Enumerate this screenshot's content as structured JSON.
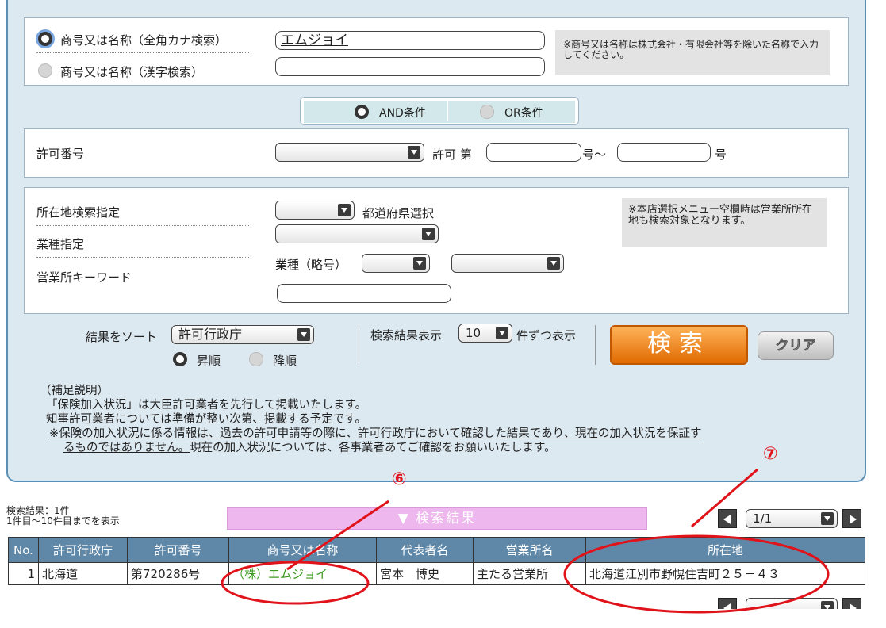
{
  "name_search": {
    "kana_label": "商号又は名称（全角カナ検索）",
    "kanji_label": "商号又は名称（漢字検索）",
    "kana_value": "エムジョイ",
    "kanji_value": "",
    "note": "※商号又は名称は株式会社・有限会社等を除いた名称で入力してください。"
  },
  "condition": {
    "and_label": "AND条件",
    "or_label": "OR条件"
  },
  "permit": {
    "label": "許可番号",
    "prefix": "許可 第",
    "mid": "号～",
    "suffix": "号",
    "from_value": "",
    "to_value": ""
  },
  "location": {
    "label": "所在地検索指定",
    "pref_label": "都道府県選択",
    "industry_label": "業種指定",
    "keyword_label": "営業所キーワード",
    "abbr_label": "業種（略号）",
    "note": "※本店選択メニュー空欄時は営業所所在地も検索対象となります。"
  },
  "sort": {
    "label": "結果をソート",
    "value": "許可行政庁",
    "asc": "昇順",
    "desc": "降順",
    "count_label": "検索結果表示",
    "count_value": "10",
    "count_suffix": "件ずつ表示"
  },
  "buttons": {
    "search": "検索",
    "clear": "クリア"
  },
  "explain": {
    "l1": "（補足説明）",
    "l2": "「保険加入状況」は大臣許可業者を先行して掲載いたします。",
    "l3": "知事許可業者については準備が整い次第、掲載する予定です。",
    "l4": "※保険の加入状況に係る情報は、過去の許可申請等の際に、許可行政庁において確認した結果であり、現在の加入状況を保証す",
    "l5a": "るものではありません。",
    "l5b": "現在の加入状況については、各事業者あてご確認をお願いいたします。"
  },
  "results": {
    "count_line1": "検索結果：1件",
    "count_line2": "1件目～10件目までを表示",
    "bar_title": "▼ 検索結果",
    "page": "1/1",
    "headers": [
      "No.",
      "許可行政庁",
      "許可番号",
      "商号又は名称",
      "代表者名",
      "営業所名",
      "所在地"
    ],
    "rows": [
      {
        "no": "1",
        "authority": "北海道",
        "permit_no": "第720286号",
        "name": "（株）エムジョイ",
        "rep": "宮本　博史",
        "office": "主たる営業所",
        "address": "北海道江別市野幌住吉町２５－４３"
      }
    ]
  },
  "annotations": {
    "mark6": "⑥",
    "mark7": "⑦"
  }
}
